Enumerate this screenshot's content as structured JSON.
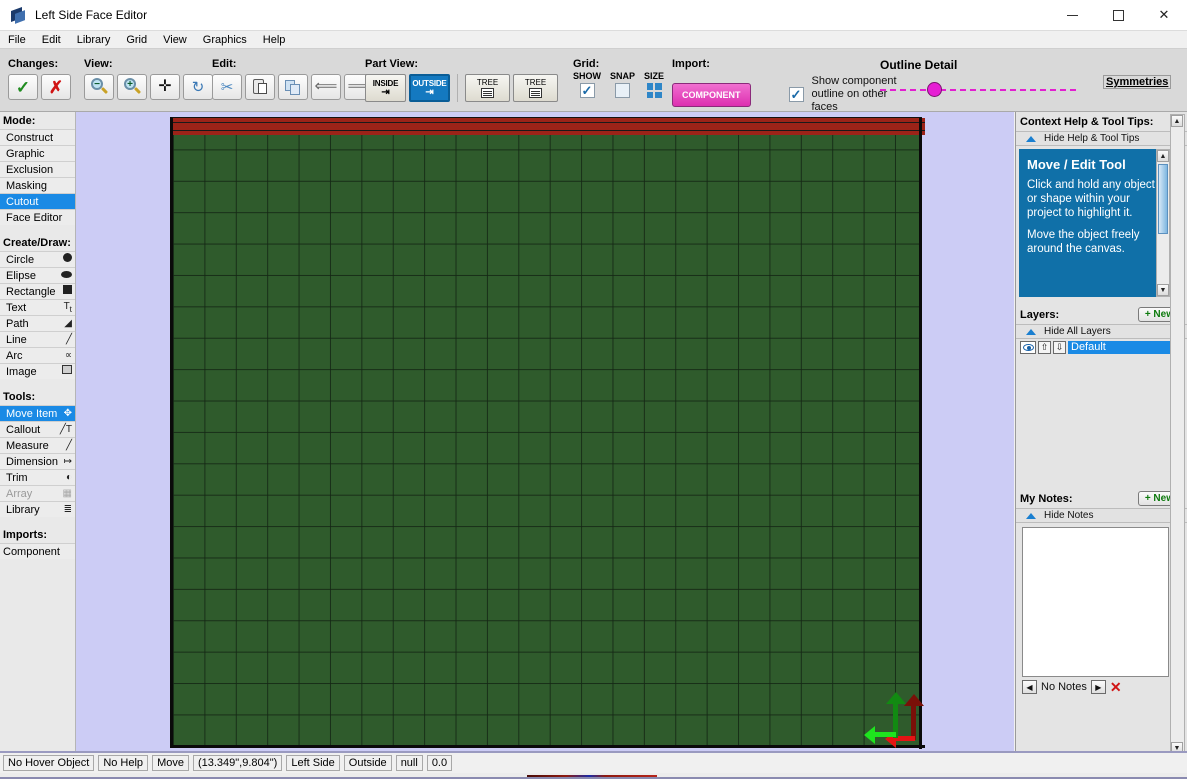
{
  "window": {
    "title": "Left Side Face Editor",
    "icon": "app-logo-icon",
    "minimize": "—",
    "maximize": "□",
    "close": "✕"
  },
  "menu": {
    "items": [
      "File",
      "Edit",
      "Library",
      "Grid",
      "View",
      "Graphics",
      "Help"
    ]
  },
  "toolbar": {
    "changes": {
      "label": "Changes:",
      "accept": "✓",
      "reject": "✗"
    },
    "view": {
      "label": "View:",
      "zoom_out": "zoom-out-icon",
      "zoom_in": "zoom-in-icon",
      "pan": "✛",
      "refresh": "↻"
    },
    "edit": {
      "label": "Edit:",
      "cut": "scissors-icon",
      "paste": "paste-icon",
      "copy": "copy-icon",
      "undo": "←",
      "redo": "→"
    },
    "part_view": {
      "label": "Part View:",
      "inside": "INSIDE",
      "outside": "OUTSIDE",
      "tree1": "TREE",
      "tree2": "TREE",
      "active": "OUTSIDE"
    },
    "grid": {
      "label": "Grid:",
      "show_label": "SHOW",
      "snap_label": "SNAP",
      "size_label": "SIZE",
      "show_checked": true,
      "snap_checked": false
    },
    "import": {
      "label": "Import:",
      "component_button": "COMPONENT",
      "show_outline_checked": true,
      "show_outline_text": "Show component outline on other faces"
    },
    "outline_detail": {
      "label": "Outline Detail",
      "knob_color": "#e61fd4",
      "track_color": "#e21fd0"
    },
    "symmetries": "Symmetries"
  },
  "sidebar": {
    "mode": {
      "heading": "Mode:",
      "items": [
        {
          "label": "Construct",
          "selected": false
        },
        {
          "label": "Graphic",
          "selected": false
        },
        {
          "label": "Exclusion",
          "selected": false
        },
        {
          "label": "Masking",
          "selected": false
        },
        {
          "label": "Cutout",
          "selected": true
        },
        {
          "label": "Face Editor",
          "selected": false
        }
      ]
    },
    "create_draw": {
      "heading": "Create/Draw:",
      "items": [
        {
          "label": "Circle",
          "icon": "circle-icon"
        },
        {
          "label": "Elipse",
          "icon": "ellipse-icon"
        },
        {
          "label": "Rectangle",
          "icon": "rectangle-icon"
        },
        {
          "label": "Text",
          "icon": "text-icon"
        },
        {
          "label": "Path",
          "icon": "path-icon"
        },
        {
          "label": "Line",
          "icon": "line-icon"
        },
        {
          "label": "Arc",
          "icon": "arc-icon"
        },
        {
          "label": "Image",
          "icon": "image-icon"
        }
      ]
    },
    "tools": {
      "heading": "Tools:",
      "items": [
        {
          "label": "Move Item",
          "icon": "move-icon",
          "selected": true,
          "disabled": false
        },
        {
          "label": "Callout",
          "icon": "callout-icon",
          "selected": false,
          "disabled": false
        },
        {
          "label": "Measure",
          "icon": "measure-icon",
          "selected": false,
          "disabled": false
        },
        {
          "label": "Dimension",
          "icon": "dimension-icon",
          "selected": false,
          "disabled": false
        },
        {
          "label": "Trim",
          "icon": "trim-icon",
          "selected": false,
          "disabled": false
        },
        {
          "label": "Array",
          "icon": "array-icon",
          "selected": false,
          "disabled": true
        },
        {
          "label": "Library",
          "icon": "library-icon",
          "selected": false,
          "disabled": false
        }
      ]
    },
    "imports": {
      "heading": "Imports:",
      "items": [
        {
          "label": "Component"
        }
      ]
    }
  },
  "right_panel": {
    "help": {
      "title": "Context Help & Tool Tips:",
      "collapse": "Hide Help & Tool Tips",
      "tip_title": "Move / Edit Tool",
      "tip_body_1": "Click and hold any object or shape within your project to highlight it.",
      "tip_body_2": "Move the object freely around the canvas."
    },
    "layers": {
      "title": "Layers:",
      "new_button": "+ New",
      "collapse": "Hide All Layers",
      "rows": [
        {
          "name": "Default",
          "visible": true,
          "selected": true
        }
      ]
    },
    "notes": {
      "title": "My Notes:",
      "new_button": "+ New",
      "collapse": "Hide Notes",
      "content": "",
      "nav_prev": "◀",
      "nav_next": "▶",
      "status": "No Notes",
      "delete": "✕"
    }
  },
  "statusbar": {
    "fields": [
      "No Hover Object",
      "No Help",
      "Move",
      "(13.349\",9.804\")",
      "Left Side",
      "Outside",
      "null",
      "0.0"
    ]
  },
  "canvas": {
    "paper_color": "#2f5b2c",
    "background_color": "#ccccf5",
    "band_color": "#9c2318",
    "axis_green": "#1ee41e",
    "axis_red": "#e41414"
  }
}
